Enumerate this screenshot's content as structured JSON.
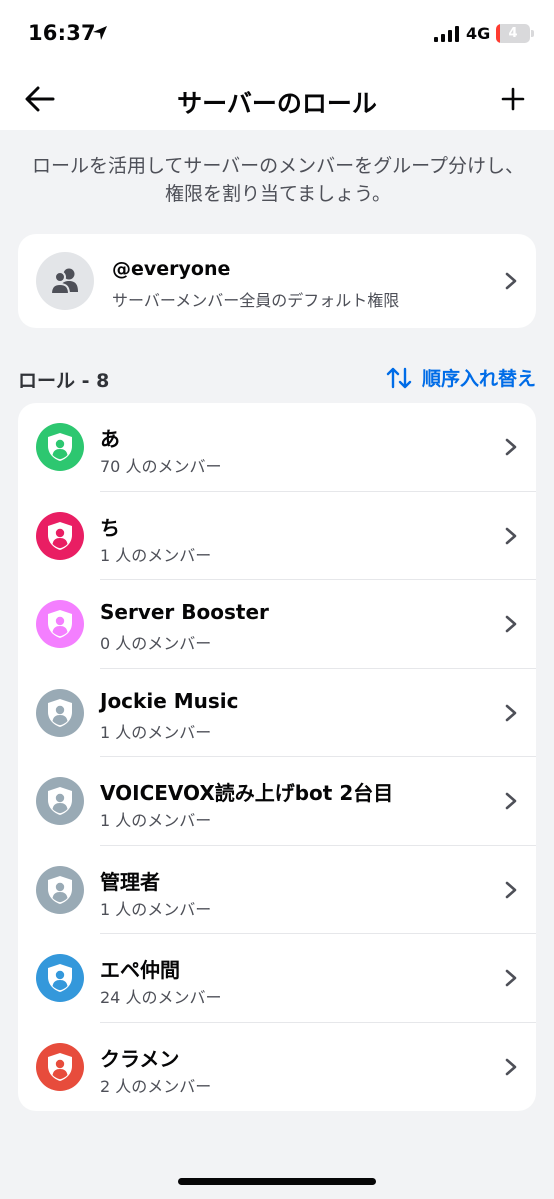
{
  "status": {
    "time": "16:37",
    "network": "4G",
    "battery": "4"
  },
  "header": {
    "title": "サーバーのロール"
  },
  "description": "ロールを活用してサーバーのメンバーをグループ分けし、権限を割り当てましょう。",
  "everyone": {
    "name": "@everyone",
    "subtitle": "サーバーメンバー全員のデフォルト権限"
  },
  "roles_section": {
    "heading": "ロール - 8",
    "reorder_label": "順序入れ替え"
  },
  "colors": {
    "accent": "#006ce7"
  },
  "roles": [
    {
      "name": "あ",
      "count": "70 人のメンバー",
      "color": "#2dc770"
    },
    {
      "name": "ち",
      "count": "1 人のメンバー",
      "color": "#e91e63"
    },
    {
      "name": "Server Booster",
      "count": "0 人のメンバー",
      "color": "#f47fff"
    },
    {
      "name": "Jockie Music",
      "count": "1 人のメンバー",
      "color": "#99aab5"
    },
    {
      "name": "VOICEVOX読み上げbot 2台目",
      "count": "1 人のメンバー",
      "color": "#99aab5"
    },
    {
      "name": "管理者",
      "count": "1 人のメンバー",
      "color": "#99aab5"
    },
    {
      "name": "エペ仲間",
      "count": "24 人のメンバー",
      "color": "#3498db"
    },
    {
      "name": "クラメン",
      "count": "2 人のメンバー",
      "color": "#e74c3c"
    }
  ]
}
